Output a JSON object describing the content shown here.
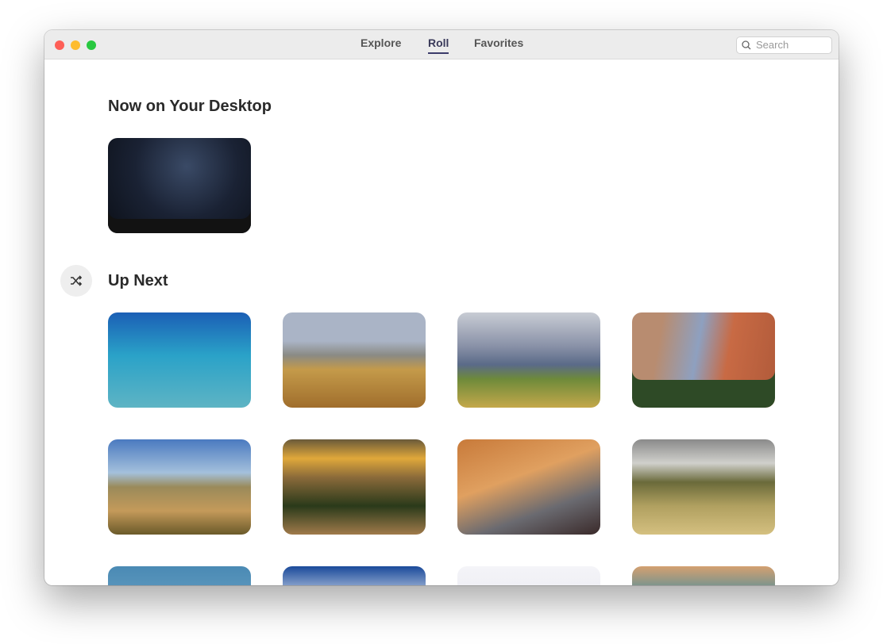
{
  "titlebar": {
    "tabs": [
      {
        "label": "Explore",
        "active": false
      },
      {
        "label": "Roll",
        "active": true
      },
      {
        "label": "Favorites",
        "active": false
      }
    ],
    "search_placeholder": "Search"
  },
  "sections": {
    "now": {
      "title": "Now on Your Desktop"
    },
    "next": {
      "title": "Up Next"
    }
  },
  "colors": {
    "accent": "#3c3c6a",
    "close": "#fe5f57",
    "minimize": "#febc2e",
    "zoom": "#28c840"
  }
}
